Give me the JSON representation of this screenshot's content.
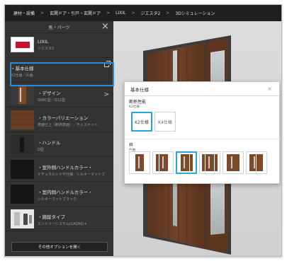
{
  "breadcrumb": [
    "建材・設備",
    "玄関ドア・引戸・玄関ドア",
    "LIXIL",
    "ジエスタ2",
    "3Dシミュレーション"
  ],
  "sidebar": {
    "header_title": "色・パーツ",
    "close_icon": "close-icon",
    "items": [
      {
        "title": "LIXIL",
        "sub": "ジエスタ2"
      },
      {
        "title": "・基本仕様",
        "sub": "K2仕様／片袖"
      },
      {
        "title": "・デザイン",
        "sub": "G08C型／G12型"
      },
      {
        "title": "・カラーバリエーション",
        "sub": "表面仕上（断熱表面）／チェスナット"
      },
      {
        "title": "・ハンドル",
        "sub": "D型"
      },
      {
        "title": "・室外側ハンドルカラー・",
        "sub": "ナチュラルシナ不仕様／シルキーマットブラック"
      },
      {
        "title": "・室内側ハンドルカラー・",
        "sub": "シルキーマットブラック"
      },
      {
        "title": "・施錠タイプ",
        "sub": "エントリーシステム(CAZAS)+"
      }
    ],
    "footer_button": "その他オプションを開く"
  },
  "modal": {
    "title": "基本仕様",
    "close": "×",
    "section1_title": "断熱性能",
    "section1_sub": "K2仕様",
    "options": [
      "K2仕様",
      "K4仕様"
    ],
    "selected_option": "K2仕様",
    "section2_title": "枠",
    "section2_sub": "片袖",
    "frame_options_count": 6,
    "frame_selected_index": 2
  },
  "colors": {
    "accent_blue": "#2aa6df",
    "highlight_blue": "#2e8bd1",
    "door_brown": "#6a3e24",
    "lixil_red": "#c8102e"
  }
}
